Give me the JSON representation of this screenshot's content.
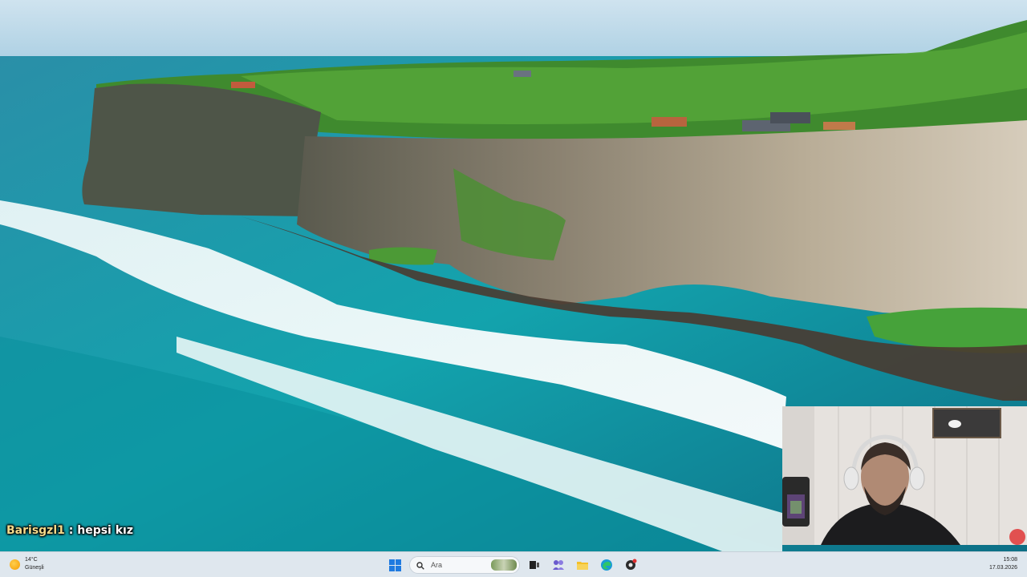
{
  "chat": {
    "username": "Barisgzl1",
    "separator": " : ",
    "message": "hepsi kız"
  },
  "taskbar": {
    "weather": {
      "temperature": "14°C",
      "condition": "Güneşli",
      "icon": "sun-icon"
    },
    "search": {
      "placeholder": "Ara"
    },
    "pinned_icons": [
      "windows-start-icon",
      "search-icon",
      "task-view-icon",
      "teams-icon",
      "file-explorer-icon",
      "edge-icon",
      "app-icon"
    ],
    "clock": {
      "time": "15:08",
      "date": "17.03.2026"
    },
    "colors": {
      "background": "#dfe7ee",
      "start_blue": "#1f7ae0"
    }
  }
}
